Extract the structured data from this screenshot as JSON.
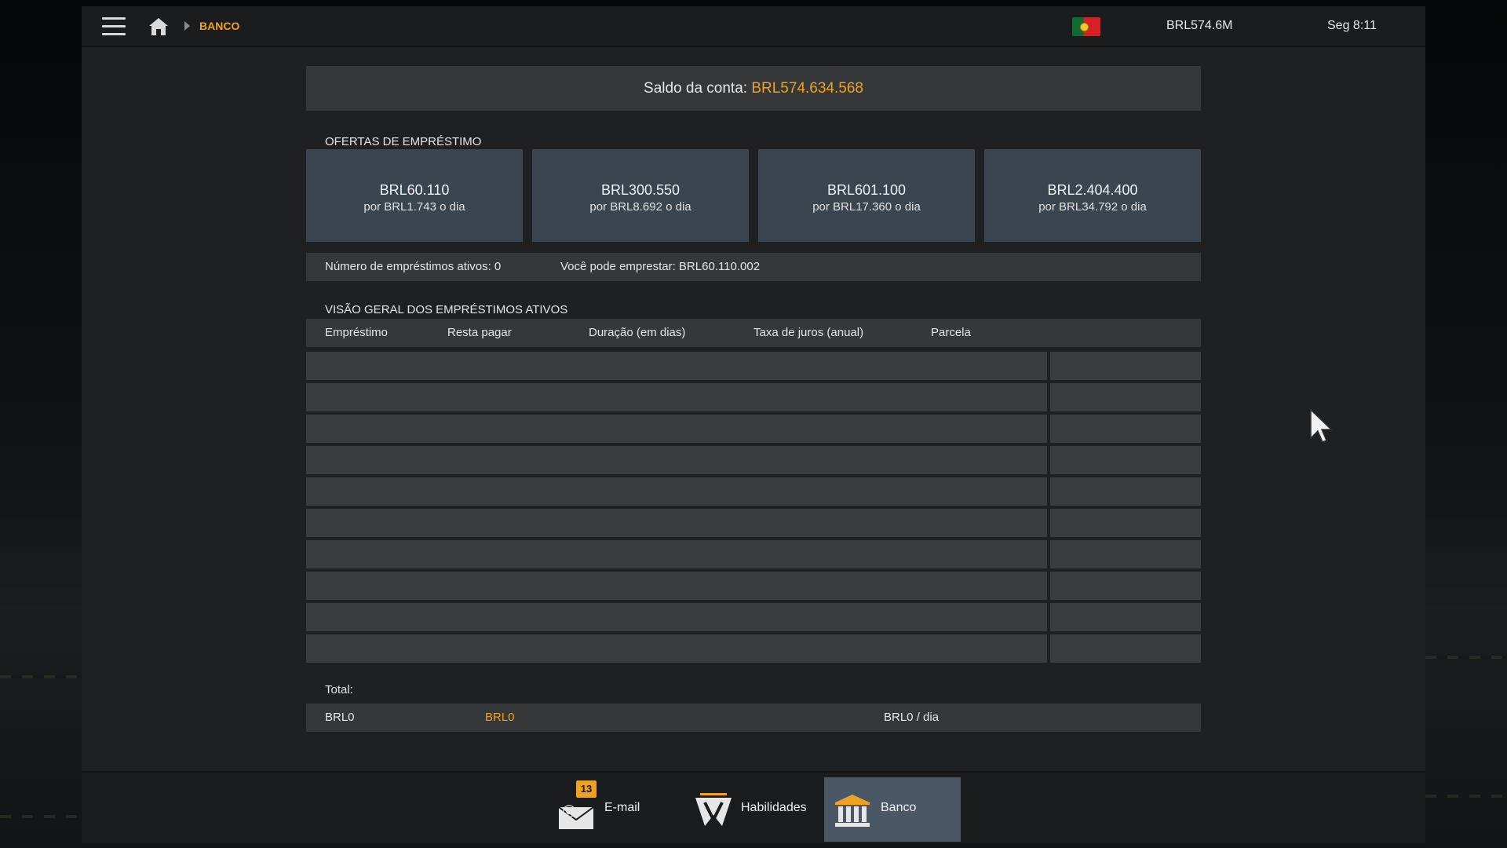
{
  "topbar": {
    "breadcrumb": "BANCO",
    "money": "BRL574.6M",
    "time": "Seg 8:11",
    "icons": [
      "menu-icon",
      "home-icon",
      "portugal-flag-icon"
    ]
  },
  "balance": {
    "label": "Saldo da conta:",
    "value": "BRL574.634.568"
  },
  "offers_title": "OFERTAS DE EMPRÉSTIMO",
  "offers": [
    {
      "amount": "BRL60.110",
      "rate": "por BRL1.743 o dia"
    },
    {
      "amount": "BRL300.550",
      "rate": "por BRL8.692 o dia"
    },
    {
      "amount": "BRL601.100",
      "rate": "por BRL17.360 o dia"
    },
    {
      "amount": "BRL2.404.400",
      "rate": "por BRL34.792 o dia"
    }
  ],
  "info": {
    "active_loans": "Número de empréstimos ativos: 0",
    "can_borrow": "Você pode emprestar: BRL60.110.002"
  },
  "overview_title": "VISÃO GERAL DOS EMPRÉSTIMOS ATIVOS",
  "table": {
    "headers": [
      "Empréstimo",
      "Resta pagar",
      "Duração (em dias)",
      "Taxa de juros (anual)",
      "Parcela"
    ],
    "rows": [
      [],
      [],
      [],
      [],
      [],
      [],
      [],
      [],
      [],
      []
    ]
  },
  "total": {
    "label": "Total:",
    "loan": "BRL0",
    "remaining": "BRL0",
    "installment": "BRL0 / dia"
  },
  "bottom_nav": [
    {
      "label": "E-mail",
      "icon": "email-icon",
      "badge": "13"
    },
    {
      "label": "Habilidades",
      "icon": "skills-icon"
    },
    {
      "label": "Banco",
      "icon": "bank-icon",
      "active": true
    }
  ],
  "colors": {
    "accent": "#f0a11f",
    "offer_card": "#3a4550",
    "active_nav": "#4a5865",
    "panel_bar": "#363738"
  }
}
